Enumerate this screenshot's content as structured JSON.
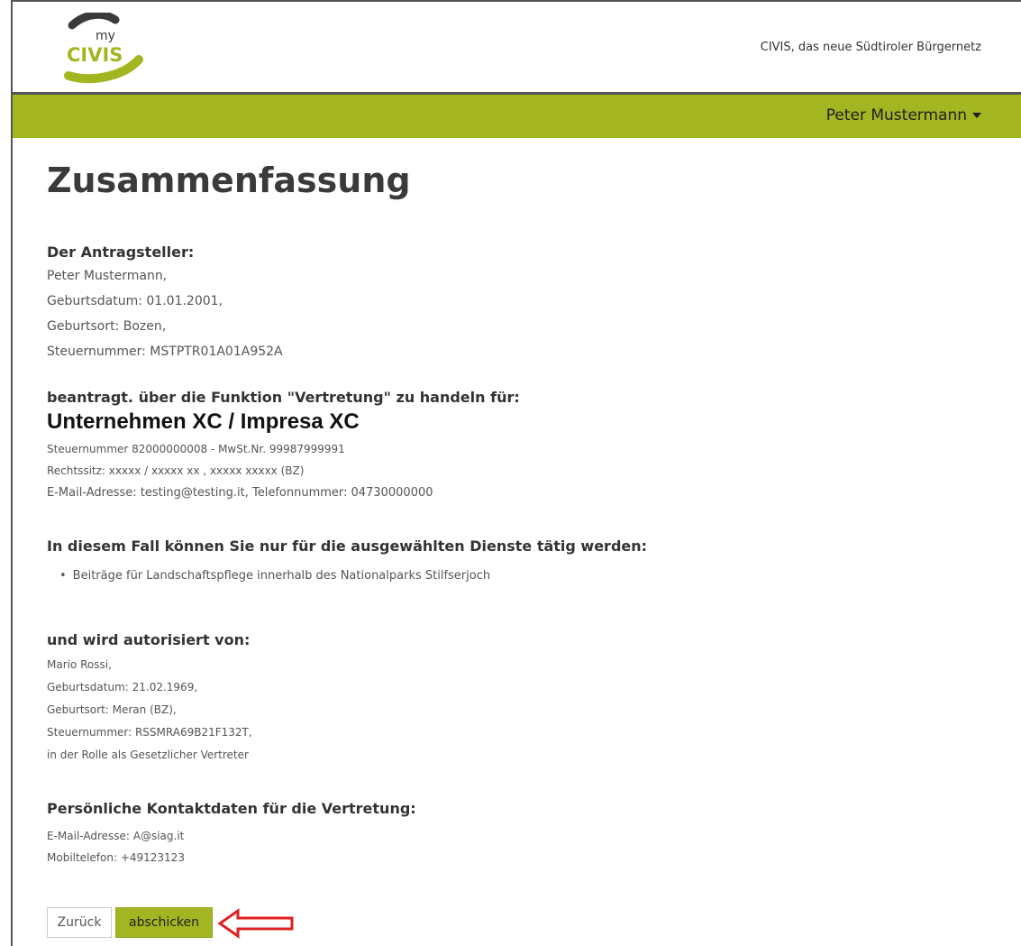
{
  "header": {
    "logo_small": "my",
    "logo_big": "CIVIS",
    "tagline": "CIVIS, das neue Südtiroler Bürgernetz"
  },
  "nav": {
    "user": "Peter Mustermann"
  },
  "page": {
    "title": "Zusammenfassung",
    "applicant": {
      "heading": "Der Antragsteller:",
      "lines": [
        "Peter Mustermann,",
        "Geburtsdatum: 01.01.2001,",
        "Geburtsort: Bozen,",
        "Steuernummer: MSTPTR01A01A952A"
      ]
    },
    "represent": {
      "heading": "beantragt. über die Funktion \"Vertretung\" zu handeln für:",
      "company": "Unternehmen XC / Impresa XC",
      "lines": [
        "Steuernummer 82000000008  - MwSt.Nr. 99987999991",
        "Rechtssitz: xxxxx  / xxxxx  xx , xxxxx  xxxxx (BZ)",
        "E-Mail-Adresse: testing@testing.it, Telefonnummer: 04730000000"
      ]
    },
    "services": {
      "heading": "In diesem Fall können Sie nur für die ausgewählten Dienste tätig werden:",
      "items": [
        "Beiträge für Landschaftspflege innerhalb des Nationalparks Stilfserjoch"
      ]
    },
    "authorized": {
      "heading": "und wird autorisiert von:",
      "lines": [
        "Mario Rossi,",
        "Geburtsdatum: 21.02.1969,",
        "Geburtsort: Meran (BZ),",
        "Steuernummer: RSSMRA69B21F132T,",
        "in der Rolle als Gesetzlicher Vertreter"
      ]
    },
    "contact": {
      "heading": "Persönliche Kontaktdaten für die Vertretung:",
      "lines": [
        "E-Mail-Adresse: A@siag.it",
        "Mobiltelefon: +49123123"
      ]
    }
  },
  "buttons": {
    "back": "Zurück",
    "submit": "abschicken"
  },
  "colors": {
    "accent": "#a3b521",
    "arrow": "#e02020"
  }
}
